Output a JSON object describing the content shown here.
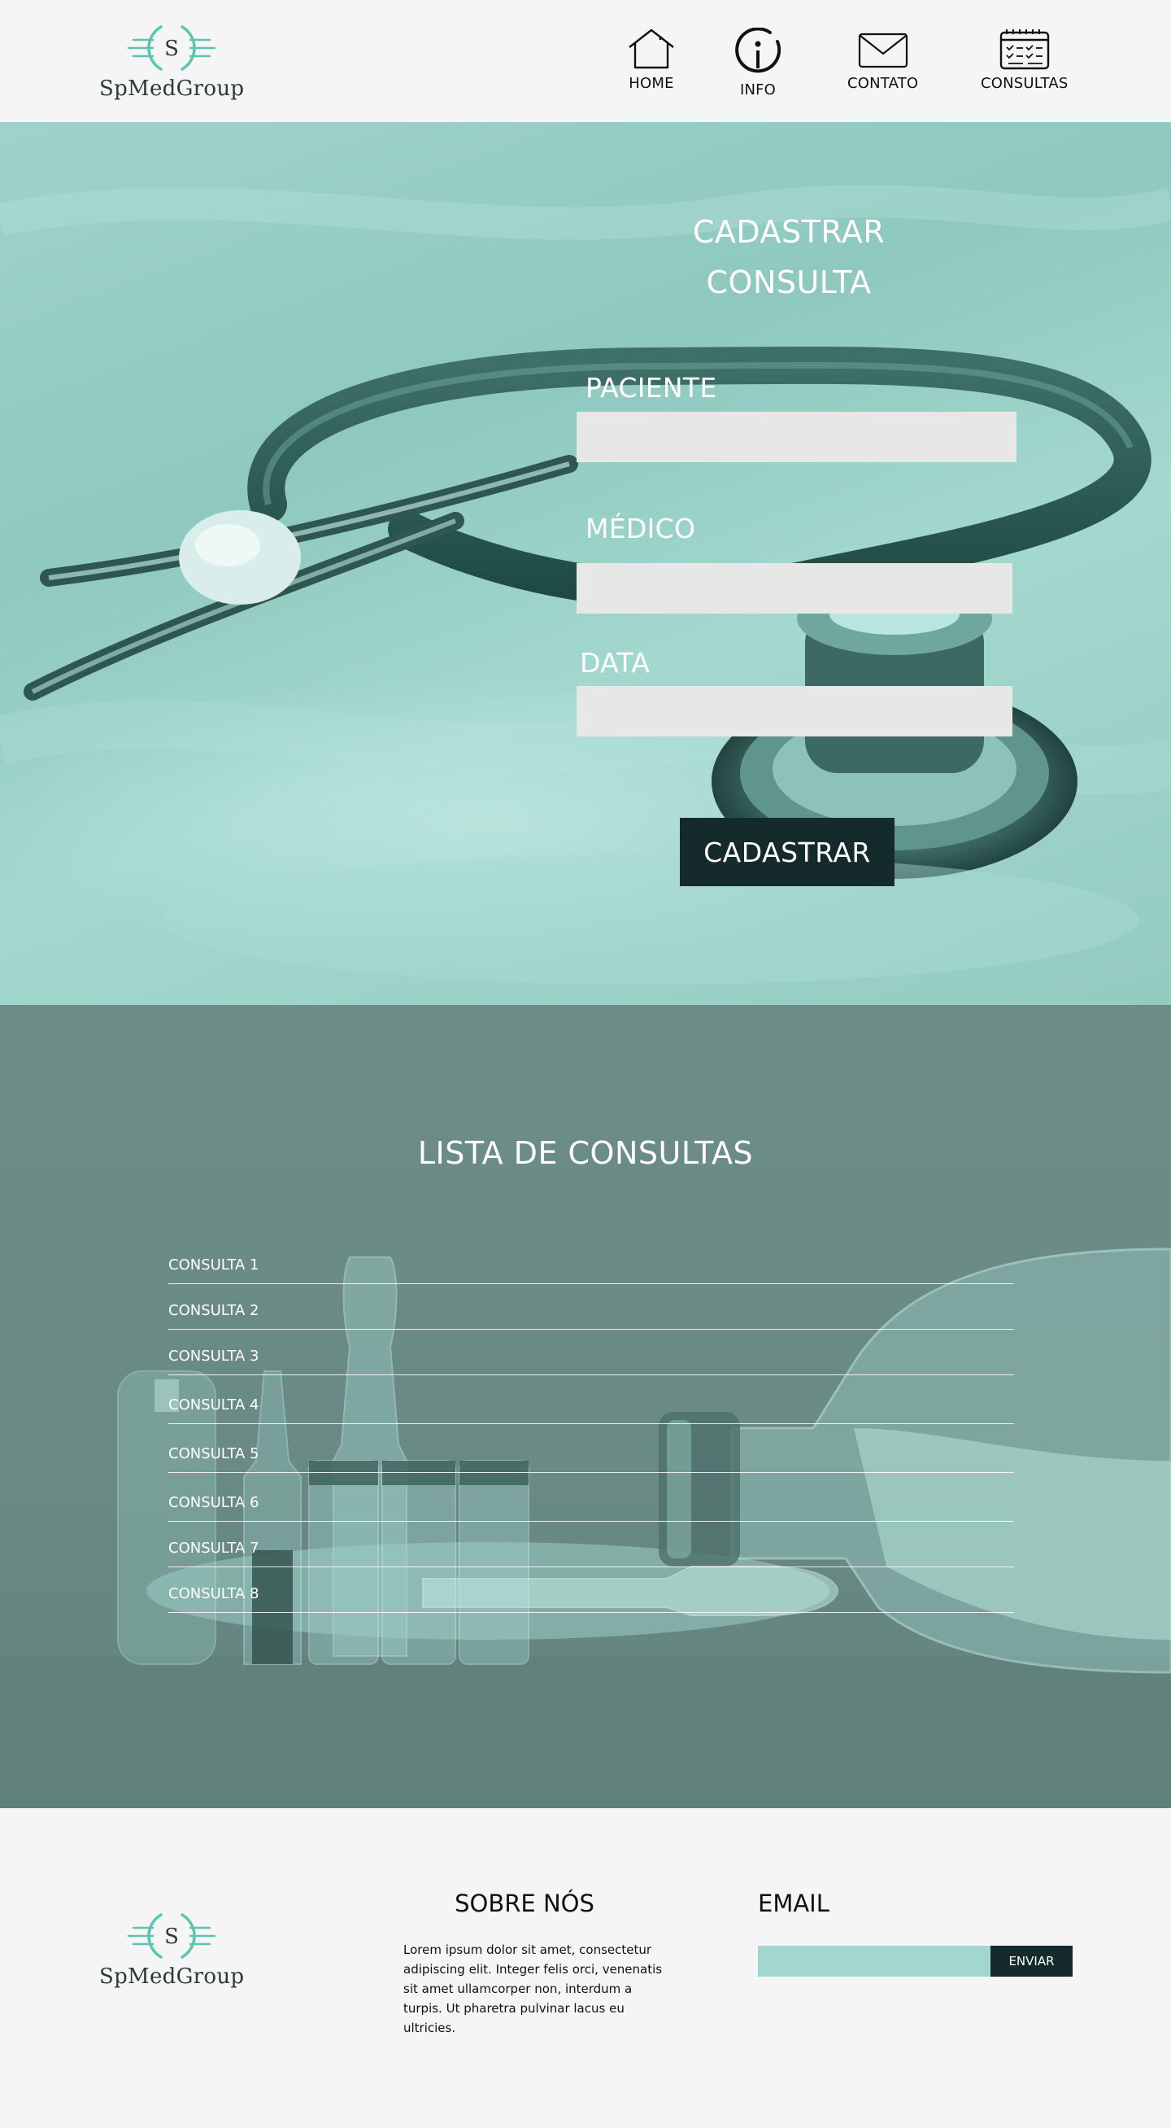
{
  "brand": {
    "logo_letter": "S",
    "name": "SpMedGroup",
    "accent_color": "#5cc3b5"
  },
  "nav": {
    "items": [
      {
        "label": "HOME",
        "icon": "home-icon"
      },
      {
        "label": "INFO",
        "icon": "info-icon"
      },
      {
        "label": "CONTATO",
        "icon": "envelope-icon"
      },
      {
        "label": "CONSULTAS",
        "icon": "calendar-icon"
      }
    ]
  },
  "form": {
    "title_line1": "CADASTRAR",
    "title_line2": "CONSULTA",
    "fields": [
      {
        "label": "PACIENTE",
        "value": ""
      },
      {
        "label": "MÉDICO",
        "value": ""
      },
      {
        "label": "DATA",
        "value": ""
      }
    ],
    "submit_label": "CADASTRAR"
  },
  "list": {
    "title": "LISTA DE CONSULTAS",
    "items": [
      "CONSULTA 1",
      "CONSULTA 2",
      "CONSULTA 3",
      "CONSULTA 4",
      "CONSULTA 5",
      "CONSULTA 6",
      "CONSULTA 7",
      "CONSULTA 8"
    ]
  },
  "footer": {
    "about_title": "SOBRE NÓS",
    "about_text": "Lorem ipsum dolor sit amet, consectetur adipiscing elit. Integer felis orci, venenatis sit amet ullamcorper non, interdum a turpis. Ut pharetra pulvinar lacus eu ultricies.",
    "email_title": "EMAIL",
    "email_placeholder": "",
    "send_label": "ENVIAR"
  },
  "colors": {
    "hero_tint": "#9fd3ca",
    "list_tint": "#6a8a85",
    "dark_button": "#152a2a",
    "input_grey": "#e7e7e7",
    "email_input": "#a1d7cf"
  }
}
